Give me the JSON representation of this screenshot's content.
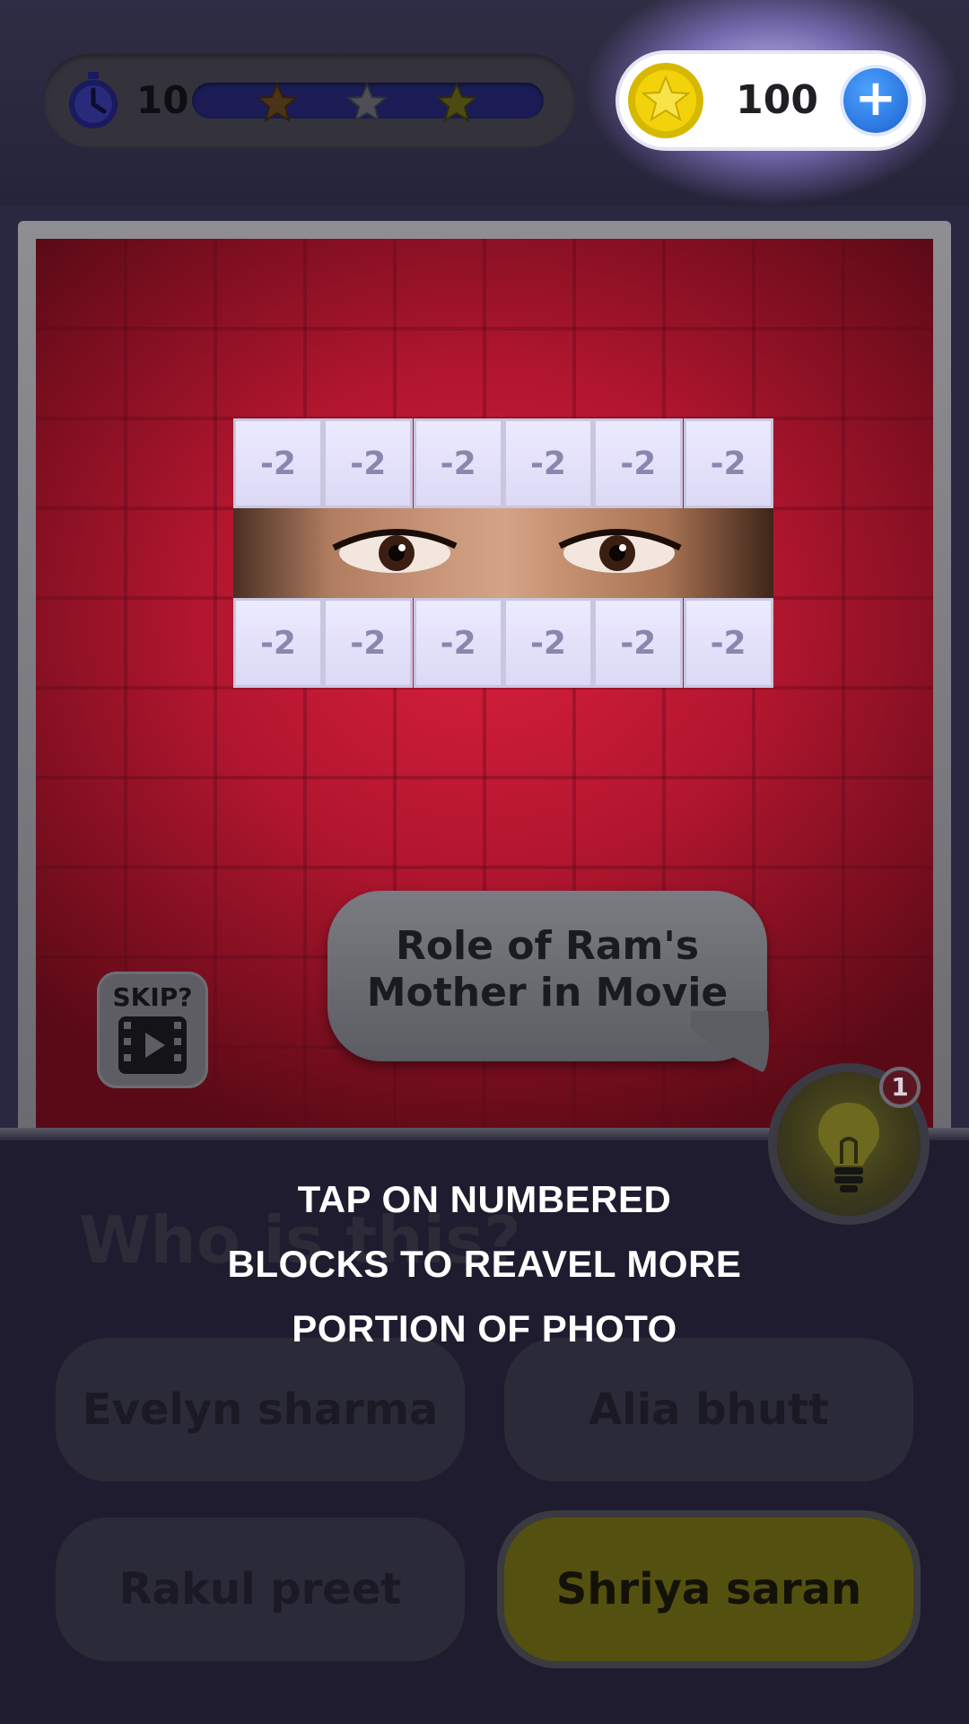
{
  "header": {
    "timer_value": "10",
    "stars": [
      "bronze-star-icon",
      "silver-star-icon",
      "gold-star-icon"
    ],
    "progress": 0.0,
    "coins": "100"
  },
  "puzzle": {
    "tile_value": "-2",
    "top_row": [
      "-2",
      "-2",
      "-2",
      "-2",
      "-2",
      "-2"
    ],
    "bottom_row": [
      "-2",
      "-2",
      "-2",
      "-2",
      "-2",
      "-2"
    ],
    "clue_line1": "Role of Ram's",
    "clue_line2": "Mother in Movie",
    "skip_label": "SKIP?"
  },
  "hint": {
    "badge_count": "1"
  },
  "question": "Who is this?",
  "answers": [
    "Evelyn sharma",
    "Alia bhutt",
    "Rakul preet",
    "Shriya saran"
  ],
  "tutorial": {
    "line1": "TAP ON NUMBERED",
    "line2": "BLOCKS TO REAVEL MORE",
    "line3": "PORTION OF PHOTO"
  },
  "colors": {
    "accent_blue": "#1a5fd0",
    "board_red": "#d81f3d",
    "coin_gold": "#f2d20a",
    "answer_highlight": "#54500f"
  }
}
